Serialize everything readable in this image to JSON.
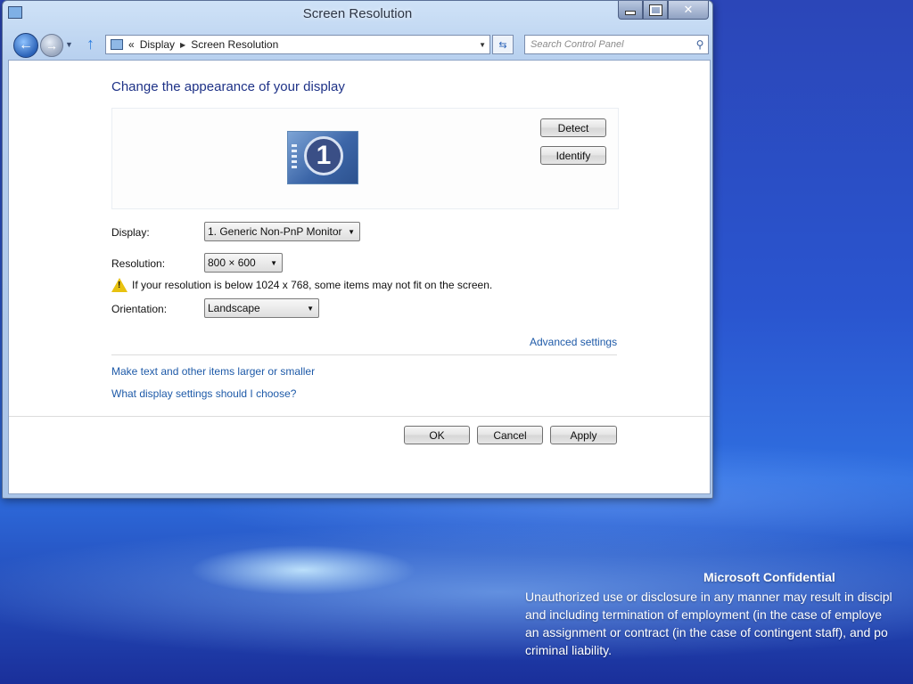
{
  "window": {
    "title": "Screen Resolution"
  },
  "nav": {
    "breadcrumb": [
      "Display",
      "Screen Resolution"
    ],
    "breadcrumb_prefix": "«",
    "search_placeholder": "Search Control Panel"
  },
  "content": {
    "heading": "Change the appearance of your display",
    "monitor_number": "1",
    "detect_label": "Detect",
    "identify_label": "Identify",
    "display_label": "Display:",
    "display_value": "1. Generic Non-PnP Monitor",
    "resolution_label": "Resolution:",
    "resolution_value": "800 × 600",
    "warning_text": "If your resolution is below 1024 x 768, some items may not fit on the screen.",
    "orientation_label": "Orientation:",
    "orientation_value": "Landscape",
    "advanced_link": "Advanced settings",
    "link_larger": "Make text and other items larger or smaller",
    "link_help": "What display settings should I choose?"
  },
  "footer": {
    "ok_label": "OK",
    "cancel_label": "Cancel",
    "apply_label": "Apply"
  },
  "desktop": {
    "confidential_title": "Microsoft Confidential",
    "confidential_lines": [
      "Unauthorized use or disclosure in any manner may result in discipl",
      "and including termination of employment (in the case of employe",
      "an assignment or contract (in the case of contingent staff), and po",
      "criminal liability."
    ]
  },
  "icons": {
    "back": "back-arrow-icon",
    "forward": "forward-arrow-icon",
    "up": "up-arrow-icon",
    "refresh": "refresh-icon",
    "search": "search-icon",
    "warning": "warning-icon"
  },
  "colors": {
    "link": "#1e5aa8",
    "heading": "#1e3287",
    "warning": "#e8c210"
  }
}
